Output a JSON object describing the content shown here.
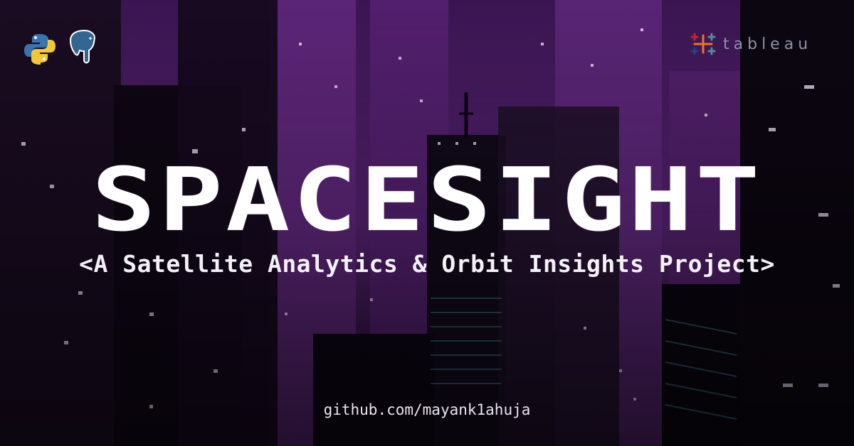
{
  "title": "SPACESIGHT",
  "subtitle": "<A Satellite Analytics & Orbit Insights Project>",
  "footer": {
    "link": "github.com/mayank1ahuja"
  },
  "logos": {
    "left": [
      {
        "icon": "python-icon"
      },
      {
        "icon": "postgresql-icon"
      }
    ],
    "right": {
      "icon": "tableau-icon",
      "text": "tableau"
    }
  },
  "colors": {
    "background_purple": "#4a1a63",
    "title": "#ffffff",
    "tableau_text": "#8d92a8"
  }
}
